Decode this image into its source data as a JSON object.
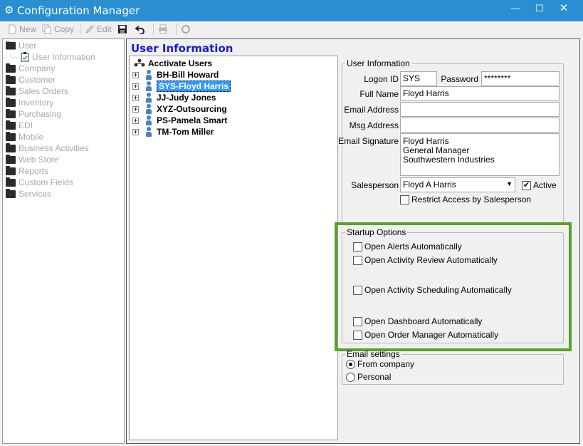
{
  "window": {
    "title": "Configuration Manager"
  },
  "toolbar": {
    "new_label": "New",
    "copy_label": "Copy",
    "edit_label": "Edit"
  },
  "nav": {
    "items": [
      {
        "label": "User"
      },
      {
        "label": "User Information"
      },
      {
        "label": "Company"
      },
      {
        "label": "Customer"
      },
      {
        "label": "Sales Orders"
      },
      {
        "label": "Inventory"
      },
      {
        "label": "Purchasing"
      },
      {
        "label": "EDI"
      },
      {
        "label": "Mobile"
      },
      {
        "label": "Business Activities"
      },
      {
        "label": "Web Store"
      },
      {
        "label": "Reports"
      },
      {
        "label": "Custom Fields"
      },
      {
        "label": "Services"
      }
    ]
  },
  "page": {
    "title": "User Information"
  },
  "tree": {
    "root_label": "Acctivate Users",
    "users": [
      {
        "label": "BH-Bill Howard"
      },
      {
        "label": "SYS-Floyd Harris"
      },
      {
        "label": "JJ-Judy Jones"
      },
      {
        "label": "XYZ-Outsourcing"
      },
      {
        "label": "PS-Pamela Smart"
      },
      {
        "label": "TM-Tom Miller"
      }
    ]
  },
  "user_info": {
    "legend": "User Information",
    "logon_id_label": "Logon ID",
    "logon_id_value": "SYS",
    "password_label": "Password",
    "password_value": "********",
    "full_name_label": "Full Name",
    "full_name_value": "Floyd Harris",
    "email_label": "Email Address",
    "email_value": "",
    "msg_label": "Msg Address",
    "msg_value": "",
    "signature_label": "Email Signature",
    "signature_lines": [
      "Floyd Harris",
      "General Manager",
      "Southwestern Industries"
    ],
    "salesperson_label": "Salesperson",
    "salesperson_value": "Floyd A Harris",
    "active_label": "Active",
    "active_checked": true,
    "restrict_label": "Restrict Access by Salesperson",
    "restrict_checked": false
  },
  "startup": {
    "legend": "Startup Options",
    "options": [
      {
        "label": "Open Alerts Automatically",
        "checked": false
      },
      {
        "label": "Open Activity Review Automatically",
        "checked": false
      },
      {
        "label": "Open Activity Scheduling Automatically",
        "checked": false
      },
      {
        "label": "Open Dashboard Automatically",
        "checked": false
      },
      {
        "label": "Open Order Manager Automatically",
        "checked": false
      }
    ],
    "highlight_color": "#5aa02c"
  },
  "email_settings": {
    "legend": "Email settings",
    "options": [
      {
        "label": "From company",
        "selected": true
      },
      {
        "label": "Personal",
        "selected": false
      }
    ]
  },
  "colors": {
    "titlebar": "#2a8fd2",
    "selection": "#3399ff",
    "page_title": "#1a1ad0"
  }
}
